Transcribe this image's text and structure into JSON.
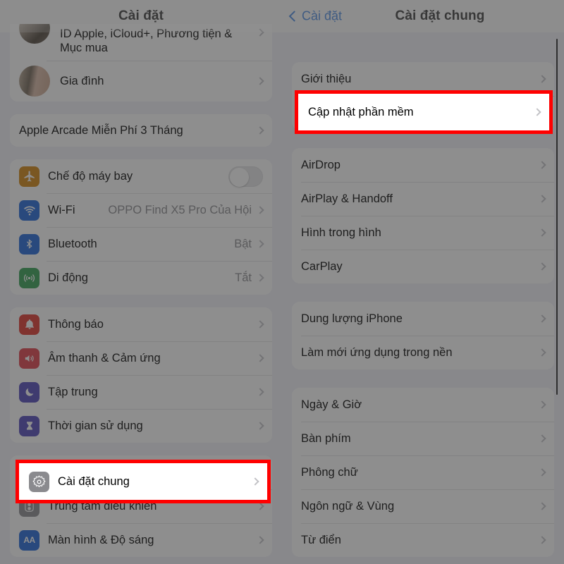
{
  "left_pane": {
    "header": {
      "title": "Cài đặt"
    },
    "groups": [
      {
        "name": "account-group",
        "rows": [
          {
            "label": "ID Apple, iCloud+, Phương tiện &\nMục mua",
            "icon": "avatar-single",
            "accessory": "chevron"
          },
          {
            "label": "Gia đình",
            "icon": "avatar-pair",
            "accessory": "chevron"
          }
        ]
      },
      {
        "name": "arcade-group",
        "rows": [
          {
            "label": "Apple Arcade Miễn Phí 3 Tháng",
            "icon": "",
            "accessory": "chevron"
          }
        ]
      },
      {
        "name": "connectivity-group",
        "rows": [
          {
            "label": "Chế độ máy bay",
            "icon": "airplane-icon",
            "icon_color": "#d2820a",
            "accessory": "toggle",
            "toggle_on": false
          },
          {
            "label": "Wi-Fi",
            "icon": "wifi-icon",
            "icon_color": "#1b62d8",
            "value": "OPPO Find X5 Pro Của Hội",
            "accessory": "chevron"
          },
          {
            "label": "Bluetooth",
            "icon": "bluetooth-icon",
            "icon_color": "#1b62d8",
            "value": "Bật",
            "accessory": "chevron"
          },
          {
            "label": "Di động",
            "icon": "cellular-icon",
            "icon_color": "#2e9e4f",
            "value": "Tắt",
            "accessory": "chevron"
          }
        ]
      },
      {
        "name": "notifications-group",
        "rows": [
          {
            "label": "Thông báo",
            "icon": "bell-icon",
            "icon_color": "#e03127",
            "accessory": "chevron"
          },
          {
            "label": "Âm thanh & Cảm ứng",
            "icon": "speaker-icon",
            "icon_color": "#e03a44",
            "accessory": "chevron"
          },
          {
            "label": "Tập trung",
            "icon": "moon-icon",
            "icon_color": "#4b42b8",
            "accessory": "chevron"
          },
          {
            "label": "Thời gian sử dụng",
            "icon": "hourglass-icon",
            "icon_color": "#4b42b8",
            "accessory": "chevron"
          }
        ]
      },
      {
        "name": "general-group",
        "rows": [
          {
            "label": "Cài đặt chung",
            "icon": "gear-icon",
            "icon_color": "#8a8a8e",
            "accessory": "chevron",
            "highlighted": true
          },
          {
            "label": "Trung tâm điều khiển",
            "icon": "control-center-icon",
            "icon_color": "#8a8a8e",
            "accessory": "chevron"
          },
          {
            "label": "Màn hình & Độ sáng",
            "icon": "display-icon",
            "icon_color": "#1b62d8",
            "accessory": "chevron"
          }
        ]
      }
    ]
  },
  "right_pane": {
    "header": {
      "back_label": "Cài đặt",
      "title": "Cài đặt chung"
    },
    "groups": [
      {
        "name": "about-group",
        "rows": [
          {
            "label": "Giới thiệu",
            "accessory": "chevron"
          },
          {
            "label": "Cập nhật phần mềm",
            "accessory": "chevron",
            "highlighted": true
          }
        ]
      },
      {
        "name": "sharing-group",
        "rows": [
          {
            "label": "AirDrop",
            "accessory": "chevron"
          },
          {
            "label": "AirPlay & Handoff",
            "accessory": "chevron"
          },
          {
            "label": "Hình trong hình",
            "accessory": "chevron"
          },
          {
            "label": "CarPlay",
            "accessory": "chevron"
          }
        ]
      },
      {
        "name": "storage-group",
        "rows": [
          {
            "label": "Dung lượng iPhone",
            "accessory": "chevron"
          },
          {
            "label": "Làm mới ứng dụng trong nền",
            "accessory": "chevron"
          }
        ]
      },
      {
        "name": "locale-group",
        "rows": [
          {
            "label": "Ngày & Giờ",
            "accessory": "chevron"
          },
          {
            "label": "Bàn phím",
            "accessory": "chevron"
          },
          {
            "label": "Phông chữ",
            "accessory": "chevron"
          },
          {
            "label": "Ngôn ngữ & Vùng",
            "accessory": "chevron"
          },
          {
            "label": "Từ điển",
            "accessory": "chevron"
          }
        ]
      }
    ]
  },
  "highlights": {
    "general": {
      "label": "Cài đặt chung",
      "icon": "gear-icon",
      "color": "#ff0000"
    },
    "software_update": {
      "label": "Cập nhật phần mềm",
      "color": "#ff0000"
    }
  },
  "colors": {
    "highlight": "#ff0000",
    "accent_blue": "#1668d8",
    "card": "#ffffff",
    "page_bg": "#f2f2f7"
  }
}
